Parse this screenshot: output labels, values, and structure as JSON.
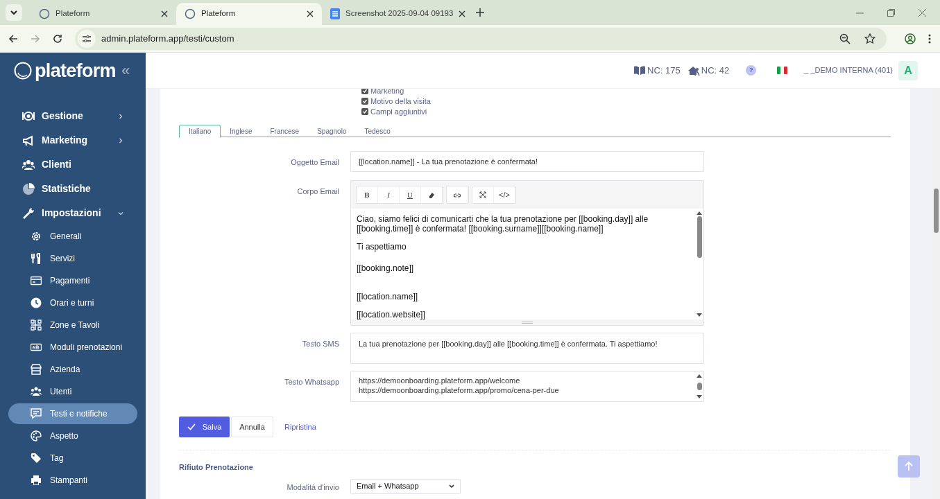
{
  "browser": {
    "tabs": [
      {
        "title": "Plateform",
        "selected": false,
        "kind": "site"
      },
      {
        "title": "Plateform",
        "selected": true,
        "kind": "site"
      },
      {
        "title": "Screenshot 2025-09-04 09193",
        "selected": false,
        "kind": "doc"
      }
    ],
    "address": "admin.plateform.app/testi/custom"
  },
  "sidebar": {
    "logo": "plateform",
    "collapse": "«",
    "items": [
      {
        "label": "Gestione",
        "expanded": false
      },
      {
        "label": "Marketing",
        "expanded": false
      },
      {
        "label": "Clienti"
      },
      {
        "label": "Statistiche"
      },
      {
        "label": "Impostazioni",
        "expanded": true,
        "children": [
          {
            "label": "Generali",
            "selected": false
          },
          {
            "label": "Servizi",
            "selected": false
          },
          {
            "label": "Pagamenti",
            "selected": false
          },
          {
            "label": "Orari e turni",
            "selected": false
          },
          {
            "label": "Zone e Tavoli",
            "selected": false
          },
          {
            "label": "Moduli prenotazioni",
            "selected": false
          },
          {
            "label": "Azienda",
            "selected": false
          },
          {
            "label": "Utenti",
            "selected": false
          },
          {
            "label": "Testi e notifiche",
            "selected": true
          },
          {
            "label": "Aspetto",
            "selected": false
          },
          {
            "label": "Tag",
            "selected": false
          },
          {
            "label": "Stampanti",
            "selected": false
          }
        ]
      }
    ]
  },
  "header": {
    "counters": [
      "NC: 175",
      "NC: 42"
    ],
    "help": "?",
    "account": "_ _DEMO INTERNA (401)",
    "avatar": "A"
  },
  "checkboxes": [
    {
      "label": "Marketing",
      "checked": true
    },
    {
      "label": "Motivo della visita",
      "checked": true
    },
    {
      "label": "Campi aggiuntivi",
      "checked": true
    }
  ],
  "language_tabs": [
    {
      "label": "Italiano",
      "selected": true
    },
    {
      "label": "Inglese",
      "selected": false
    },
    {
      "label": "Francese",
      "selected": false
    },
    {
      "label": "Spagnolo",
      "selected": false
    },
    {
      "label": "Tedesco",
      "selected": false
    }
  ],
  "email_subject": {
    "label": "Oggetto Email",
    "value": "[[location.name]] - La tua prenotazione è confermata!"
  },
  "email_body": {
    "label": "Corpo Email",
    "toolbar": [
      "B",
      "I",
      "U",
      "</>"
    ],
    "paragraphs": [
      "Ciao, siamo felici di comunicarti che la tua prenotazione per [[booking.day]] alle [[booking.time]] è confermata! [[booking.surname]][[booking.name]]",
      "Ti aspettiamo",
      "[[booking.note]]",
      "[[location.name]]",
      "[[location.website]]"
    ]
  },
  "sms": {
    "label": "Testo SMS",
    "value": "La tua prenotazione per [[booking.day]] alle [[booking.time]] è confermata. Ti aspettiamo!"
  },
  "whatsapp": {
    "label": "Testo Whatsapp",
    "lines": [
      "https://demoonboarding.plateform.app/welcome",
      "https://demoonboarding.plateform.app/promo/cena-per-due"
    ]
  },
  "actions": {
    "save": "Salva",
    "cancel": "Annulla",
    "reset": "Ripristina"
  },
  "rejection": {
    "title": "Rifiuto Prenotazione",
    "mode_label": "Modalità d'invio",
    "mode_value": "Email + Whatsapp"
  }
}
